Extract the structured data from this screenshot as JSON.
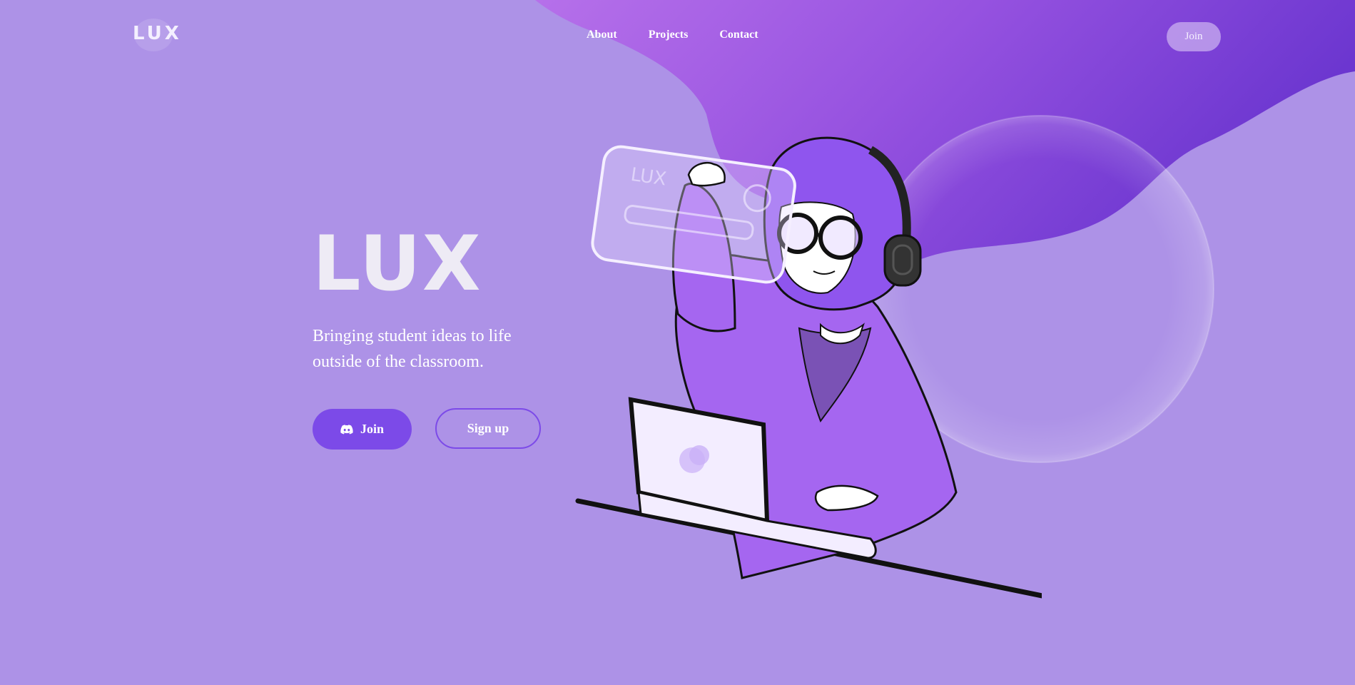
{
  "nav": {
    "logo": "LUX",
    "links": [
      "About",
      "Projects",
      "Contact"
    ],
    "join_label": "Join"
  },
  "hero": {
    "title": "LUX",
    "subtitle": "Bringing student ideas to life outside of the classroom.",
    "join_label": "Join",
    "signup_label": "Sign up",
    "join_icon": "discord-icon"
  },
  "colors": {
    "background": "#ad92e7",
    "accent": "#7c4ae8",
    "blob_start": "#b46be8",
    "blob_end": "#6a35cf"
  },
  "illustration": {
    "glass_panel_text": "LUX"
  }
}
